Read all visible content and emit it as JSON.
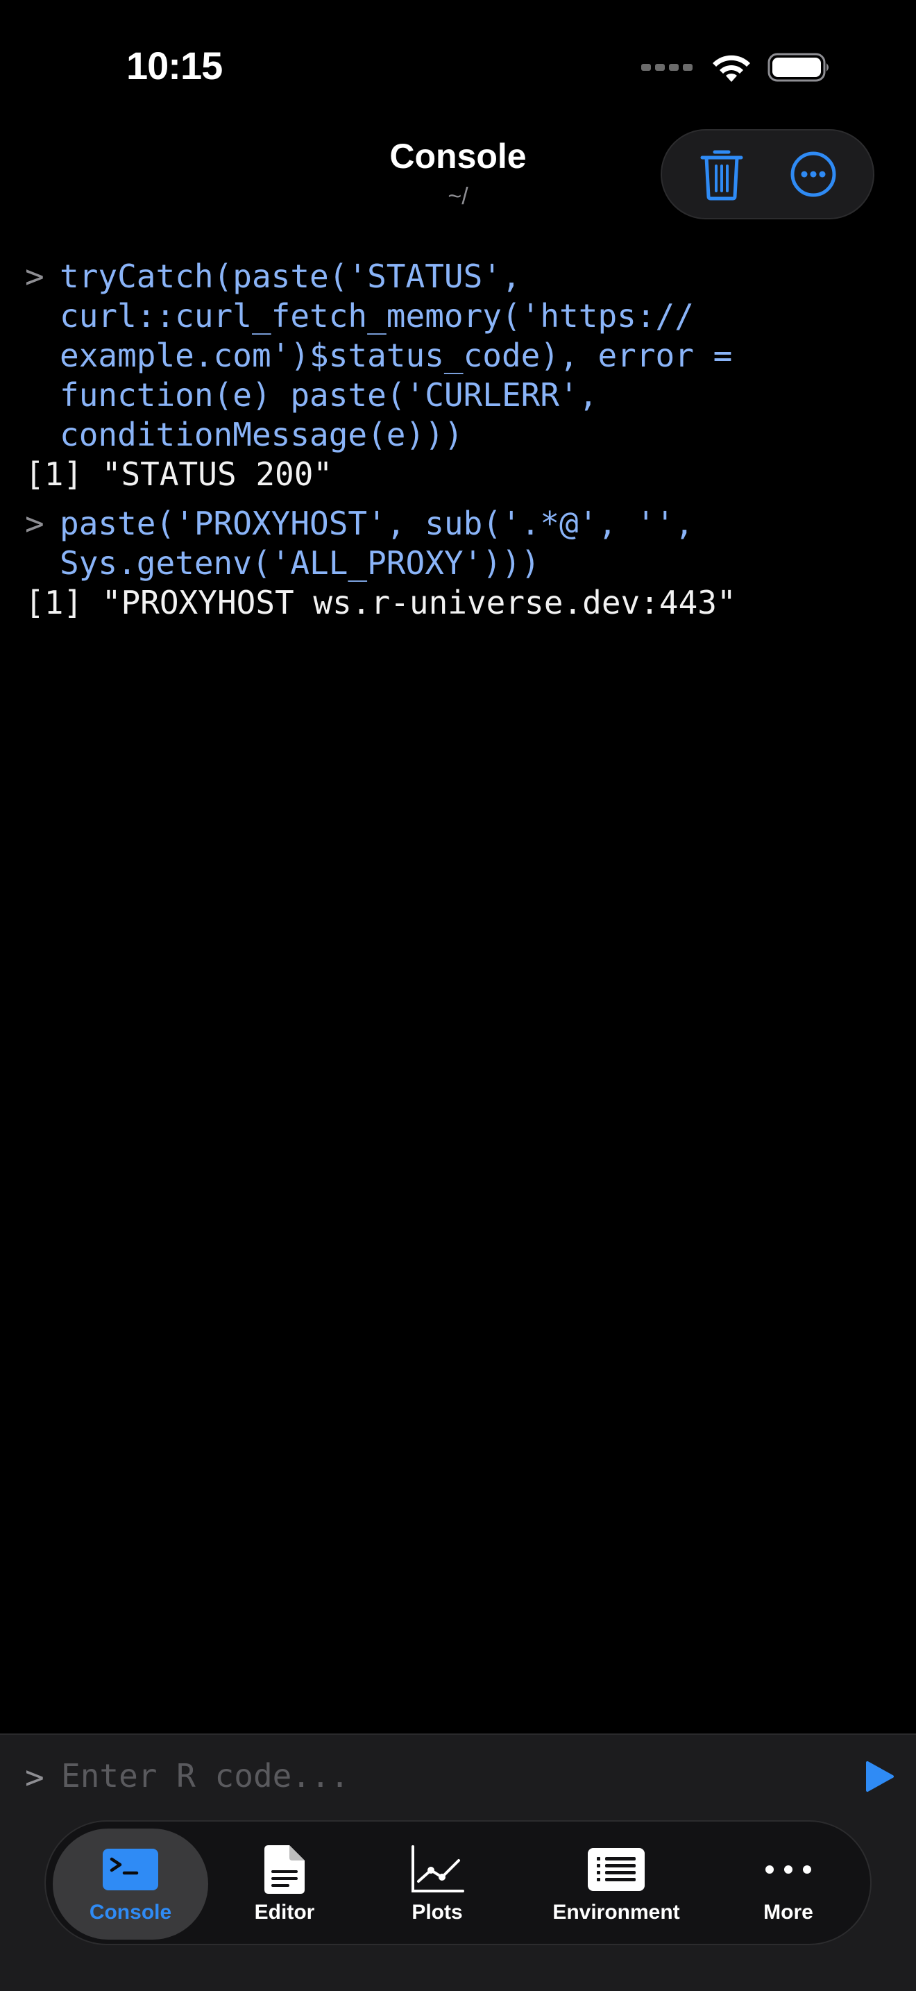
{
  "status_bar": {
    "time": "10:15"
  },
  "header": {
    "title": "Console",
    "subtitle": "~/"
  },
  "console": {
    "entries": [
      {
        "prompt": ">",
        "command": "tryCatch(paste('STATUS',\ncurl::curl_fetch_memory('https://\nexample.com')$status_code), error =\nfunction(e) paste('CURLERR',\nconditionMessage(e)))",
        "output": "[1] \"STATUS 200\""
      },
      {
        "prompt": ">",
        "command": "paste('PROXYHOST', sub('.*@', '',\nSys.getenv('ALL_PROXY')))",
        "output": "[1] \"PROXYHOST ws.r-universe.dev:443\""
      }
    ]
  },
  "input": {
    "prompt": ">",
    "placeholder": "Enter R code...",
    "value": ""
  },
  "tabs": [
    {
      "label": "Console",
      "icon": "terminal-icon",
      "active": true
    },
    {
      "label": "Editor",
      "icon": "document-icon",
      "active": false
    },
    {
      "label": "Plots",
      "icon": "line-chart-icon",
      "active": false
    },
    {
      "label": "Environment",
      "icon": "list-icon",
      "active": false
    },
    {
      "label": "More",
      "icon": "ellipsis-icon",
      "active": false
    }
  ],
  "colors": {
    "accent": "#2f8bf5",
    "command_text": "#8ab4f8",
    "output_text": "#f2f2f2",
    "background": "#000000"
  }
}
